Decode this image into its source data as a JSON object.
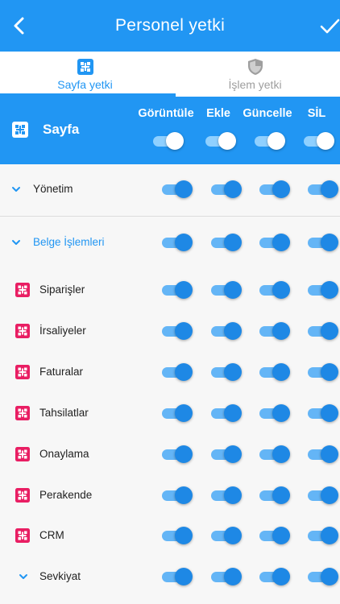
{
  "header": {
    "title": "Personel yetki"
  },
  "tabs": [
    {
      "label": "Sayfa yetki",
      "icon": "page-permission-icon",
      "active": true
    },
    {
      "label": "İşlem yetki",
      "icon": "shield-icon",
      "active": false
    }
  ],
  "permissions_header": {
    "label": "Sayfa",
    "columns": [
      "Görüntüle",
      "Ekle",
      "Güncelle",
      "SİL"
    ]
  },
  "rows": [
    {
      "label": "Yönetim",
      "type": "group"
    },
    {
      "label": "Belge İşlemleri",
      "type": "group-open"
    },
    {
      "label": "Siparişler",
      "type": "page"
    },
    {
      "label": "İrsaliyeler",
      "type": "page"
    },
    {
      "label": "Faturalar",
      "type": "page"
    },
    {
      "label": "Tahsilatlar",
      "type": "page"
    },
    {
      "label": "Onaylama",
      "type": "page"
    },
    {
      "label": "Perakende",
      "type": "page"
    },
    {
      "label": "CRM",
      "type": "page"
    },
    {
      "label": "Sevkiyat",
      "type": "group"
    }
  ],
  "colors": {
    "primary": "#2196f3",
    "page_icon": "#e91e63",
    "group_label_active": "#2196f3"
  }
}
